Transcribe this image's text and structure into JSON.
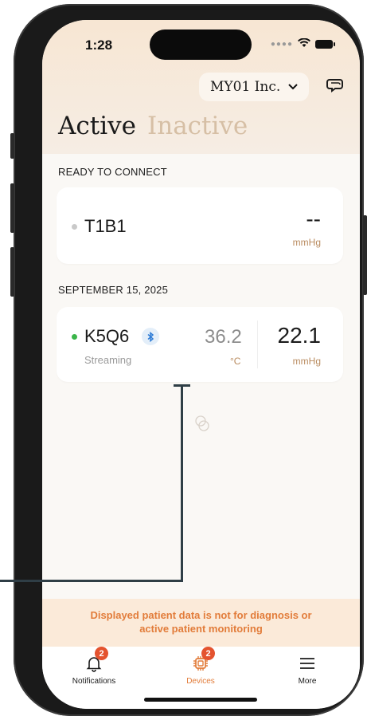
{
  "status_bar": {
    "time": "1:28"
  },
  "header": {
    "org_selector": "MY01 Inc."
  },
  "tabs": {
    "active": "Active",
    "inactive": "Inactive"
  },
  "sections": [
    {
      "label": "READY TO CONNECT",
      "devices": [
        {
          "id": "T1B1",
          "pressure": "--",
          "pressure_unit": "mmHg",
          "status_color": "#c9c9c9"
        }
      ]
    },
    {
      "label": "SEPTEMBER 15, 2025",
      "devices": [
        {
          "id": "K5Q6",
          "status": "Streaming",
          "temperature": "36.2",
          "temperature_unit": "°C",
          "pressure": "22.1",
          "pressure_unit": "mmHg",
          "status_color": "#3bb54a"
        }
      ]
    }
  ],
  "disclaimer": "Displayed patient data is not for diagnosis or active patient monitoring",
  "tabbar": {
    "items": [
      {
        "label": "Notifications",
        "badge": "2",
        "icon": "bell-icon"
      },
      {
        "label": "Devices",
        "badge": "2",
        "icon": "device-icon",
        "active": true
      },
      {
        "label": "More",
        "icon": "menu-icon"
      }
    ]
  },
  "colors": {
    "accent": "#e27c3a",
    "badge": "#e4532f",
    "inactive_tab": "#d6bfa5"
  }
}
